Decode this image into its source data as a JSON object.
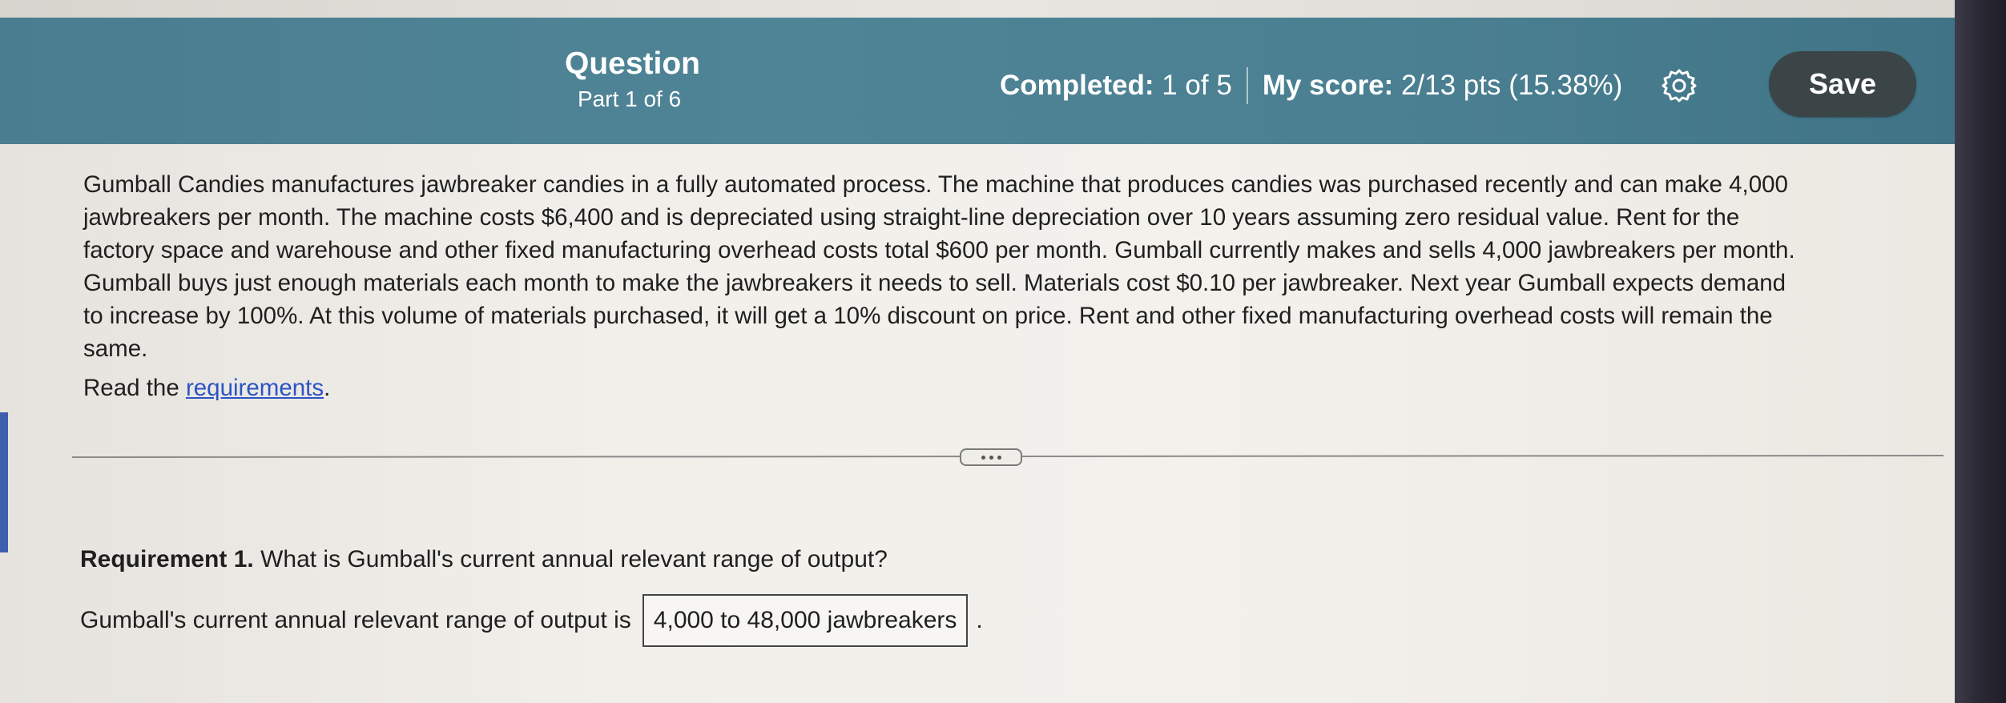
{
  "header": {
    "title": "Question",
    "part": "Part 1 of 6",
    "completed_label": "Completed:",
    "completed_value": "1 of 5",
    "score_label": "My score:",
    "score_value": "2/13 pts (15.38%)",
    "settings_icon": "gear-icon",
    "save_label": "Save"
  },
  "problem": {
    "lines": [
      "Gumball Candies manufactures jawbreaker candies in a fully automated process. The machine that produces candies was purchased recently and can make 4,000",
      "jawbreakers per month. The machine costs $6,400 and is depreciated using straight-line depreciation over 10 years assuming zero residual value. Rent for the",
      "factory space and warehouse and other fixed manufacturing overhead costs total $600 per month. Gumball currently makes and sells 4,000 jawbreakers per month.",
      "Gumball buys just enough materials each month to make the jawbreakers it needs to sell. Materials cost $0.10 per jawbreaker. Next year Gumball expects demand",
      "to increase by 100%. At this volume of materials purchased, it will get a 10% discount on price. Rent and other fixed manufacturing overhead costs will remain the",
      "same."
    ],
    "read_prefix": "Read the ",
    "read_link": "requirements",
    "read_suffix": "."
  },
  "requirement": {
    "label": "Requirement 1.",
    "question": " What is Gumball's current annual relevant range of output?",
    "answer_prefix": "Gumball's current annual relevant range of output is",
    "answer_value": "4,000 to 48,000 jawbreakers",
    "answer_suffix": "."
  },
  "colors": {
    "header_bg": "#4f8497",
    "save_bg": "#3b4447",
    "link": "#2b54c5"
  }
}
